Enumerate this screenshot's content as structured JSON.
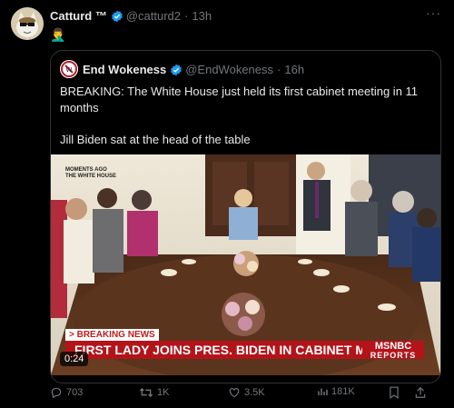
{
  "tweet": {
    "author_name": "Catturd ™",
    "handle": "@catturd2",
    "separator": "·",
    "time": "13h",
    "more": "···",
    "emoji": "🤦‍♂️"
  },
  "quote": {
    "author_name": "End Wokeness",
    "handle": "@EndWokeness",
    "separator": "·",
    "time": "16h",
    "text_1": "BREAKING: The White House just held its first cabinet meeting in 11 months",
    "text_2": "Jill Biden sat at the head of the table"
  },
  "video": {
    "corner_text": "MOMENTS AGO\nTHE WHITE HOUSE",
    "breaking_label": "> BREAKING NEWS",
    "headline": "FIRST LADY JOINS PRES. BIDEN IN CABINET MEETING",
    "network": "MSNBC",
    "network_sub": "REPORTS",
    "duration": "0:24"
  },
  "actions": {
    "replies": "703",
    "reposts": "1K",
    "likes": "3.5K",
    "views": "181K"
  },
  "colors": {
    "verified": "#1d9bf0",
    "muted": "#71767b",
    "chyron_red": "#b3141a"
  }
}
